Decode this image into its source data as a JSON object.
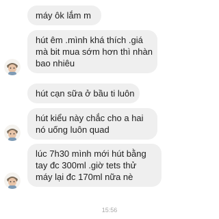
{
  "messages": [
    {
      "lines": [
        "máy ôk lắm m"
      ]
    },
    {
      "lines": [
        "hút êm .mình khá thích .giá",
        "mà bit mua sớm hơn thì nhàn",
        "bao nhiêu"
      ]
    },
    {
      "lines": [
        "hút cạn sữa ở bầu ti luôn"
      ]
    },
    {
      "lines": [
        "hút kiểu này chắc cho a hai",
        "nó uống luôn quad"
      ]
    },
    {
      "lines": [
        "lúc 7h30 mình mới hút bằng",
        "tay đc 300ml .giờ tets thử",
        "máy lại đc 170ml nữa nè"
      ]
    }
  ],
  "timestamp": "15:56",
  "avatar_icon": "baby-avatar-icon",
  "colors": {
    "bubble": "#efefef",
    "text": "#1e1e1e",
    "timestamp": "#a8a8a8"
  }
}
